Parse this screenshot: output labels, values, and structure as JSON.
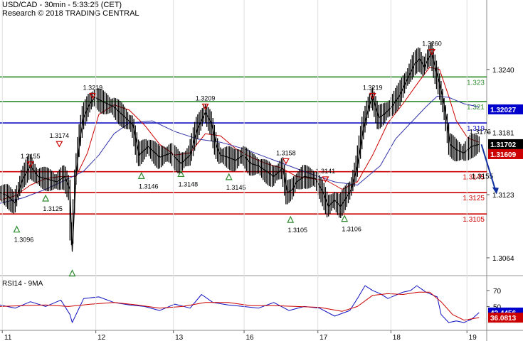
{
  "header": {
    "title": "USD/CAD - 30min - 5:33:25 (CET)",
    "subtitle": "Research © 2018 TRADING CENTRAL"
  },
  "chart_data": [
    {
      "type": "line",
      "panel": "price",
      "y_axis": {
        "ticks": [
          1.324,
          1.3181,
          1.3123,
          1.3064
        ],
        "tick_labels": [
          "1.3240",
          "1.3181",
          "1.3123",
          "1.3064"
        ],
        "ylim": [
          1.305,
          1.3285
        ],
        "side": "right"
      },
      "x_axis": {
        "tick_labels": [
          "11",
          "12",
          "13",
          "16",
          "17",
          "18",
          "19"
        ],
        "tick_index": [
          3,
          126,
          228,
          321,
          418,
          514,
          614
        ],
        "xlim": [
          0,
          640
        ]
      },
      "price_labels": [
        {
          "label": "1.32027",
          "value": 1.32027,
          "color": "#0000cc"
        },
        {
          "label": "1.31702",
          "value": 1.31702,
          "color": "#000000"
        },
        {
          "label": "1.31609",
          "value": 1.31609,
          "color": "#cc0000"
        }
      ],
      "levels": [
        {
          "label": "1.323",
          "value": 1.3233,
          "color": "#2e8b2e"
        },
        {
          "label": "1.321",
          "value": 1.321,
          "color": "#2e8b2e"
        },
        {
          "label": "1.319",
          "value": 1.319,
          "color": "#1010c0"
        },
        {
          "label": "1.3145",
          "value": 1.31445,
          "color": "#cc0000"
        },
        {
          "label": "1.3125",
          "value": 1.3125,
          "color": "#cc0000"
        },
        {
          "label": "1.3105",
          "value": 1.3105,
          "color": "#cc0000"
        }
      ],
      "level_notes": [
        {
          "label": "1.3176",
          "value": 1.3186,
          "index": 617
        },
        {
          "label": "1.3155",
          "value": 1.31445,
          "index": 620
        }
      ],
      "swing_labels": [
        {
          "kind": "high",
          "label": "1.3155",
          "value": 1.3155,
          "index": 40
        },
        {
          "kind": "high",
          "label": "1.3174",
          "value": 1.3174,
          "index": 78
        },
        {
          "kind": "high",
          "label": "1.3219",
          "value": 1.3219,
          "index": 122
        },
        {
          "kind": "high",
          "label": "1.3209",
          "value": 1.3209,
          "index": 270
        },
        {
          "kind": "high",
          "label": "1.3158",
          "value": 1.3158,
          "index": 376
        },
        {
          "kind": "high",
          "label": "1.3141",
          "value": 1.3141,
          "index": 428
        },
        {
          "kind": "high",
          "label": "1.3219",
          "value": 1.3219,
          "index": 490
        },
        {
          "kind": "high",
          "label": "1.3260",
          "value": 1.326,
          "index": 568
        },
        {
          "kind": "low",
          "label": "1.3096",
          "value": 1.3096,
          "index": 22
        },
        {
          "kind": "low",
          "label": "1.3125",
          "value": 1.3125,
          "index": 60
        },
        {
          "kind": "low",
          "label": "1.3146",
          "value": 1.3146,
          "index": 186
        },
        {
          "kind": "low",
          "label": "1.3148",
          "value": 1.3148,
          "index": 238
        },
        {
          "kind": "low",
          "label": "1.3145",
          "value": 1.3145,
          "index": 301
        },
        {
          "kind": "low",
          "label": "1.3105",
          "value": 1.3105,
          "index": 382
        },
        {
          "kind": "low",
          "label": "1.3106",
          "value": 1.3106,
          "index": 453
        },
        {
          "kind": "low",
          "label": "",
          "value": 1.3055,
          "index": 95
        }
      ],
      "series": [
        {
          "name": "",
          "role": "price",
          "color": "#000000",
          "x": [
            0,
            10,
            20,
            30,
            40,
            50,
            60,
            75,
            85,
            92,
            95,
            100,
            105,
            110,
            118,
            125,
            135,
            150,
            165,
            175,
            183,
            195,
            210,
            225,
            238,
            250,
            260,
            270,
            278,
            285,
            290,
            300,
            310,
            320,
            330,
            340,
            350,
            360,
            372,
            378,
            385,
            390,
            400,
            415,
            425,
            432,
            440,
            448,
            455,
            462,
            470,
            478,
            485,
            490,
            498,
            505,
            515,
            525,
            535,
            545,
            552,
            558,
            563,
            568,
            573,
            577,
            582,
            587,
            592,
            600,
            610,
            620,
            630
          ],
          "y": [
            1.3125,
            1.3122,
            1.3115,
            1.3138,
            1.315,
            1.314,
            1.3138,
            1.3135,
            1.314,
            1.3128,
            1.307,
            1.314,
            1.3175,
            1.3195,
            1.3208,
            1.3214,
            1.321,
            1.3205,
            1.3195,
            1.3188,
            1.316,
            1.3168,
            1.3158,
            1.3162,
            1.3152,
            1.316,
            1.3185,
            1.32,
            1.319,
            1.3168,
            1.316,
            1.3158,
            1.3155,
            1.316,
            1.3152,
            1.315,
            1.3145,
            1.314,
            1.3148,
            1.3125,
            1.3128,
            1.3135,
            1.314,
            1.3138,
            1.3125,
            1.3112,
            1.3118,
            1.3112,
            1.312,
            1.3128,
            1.315,
            1.3185,
            1.3205,
            1.3215,
            1.3195,
            1.3198,
            1.3205,
            1.3215,
            1.323,
            1.3245,
            1.325,
            1.3242,
            1.325,
            1.3255,
            1.324,
            1.323,
            1.3215,
            1.3195,
            1.317,
            1.3165,
            1.3162,
            1.3168,
            1.317
          ]
        },
        {
          "name": "",
          "role": "ma-fast",
          "color": "#cc0000",
          "x": [
            0,
            20,
            40,
            60,
            80,
            100,
            115,
            130,
            150,
            170,
            190,
            210,
            230,
            250,
            270,
            290,
            310,
            330,
            350,
            370,
            390,
            410,
            430,
            450,
            470,
            490,
            510,
            530,
            550,
            565,
            578,
            590,
            600,
            615,
            630
          ],
          "y": [
            1.3118,
            1.3122,
            1.3132,
            1.3138,
            1.314,
            1.314,
            1.3162,
            1.3198,
            1.3207,
            1.3202,
            1.3188,
            1.317,
            1.316,
            1.3162,
            1.318,
            1.3178,
            1.3166,
            1.3158,
            1.3152,
            1.3148,
            1.314,
            1.3138,
            1.3136,
            1.3128,
            1.3135,
            1.316,
            1.319,
            1.3208,
            1.3228,
            1.3242,
            1.324,
            1.3215,
            1.3192,
            1.3176,
            1.3172
          ]
        },
        {
          "name": "",
          "role": "ma-slow",
          "color": "#3333aa",
          "x": [
            0,
            30,
            60,
            90,
            110,
            130,
            150,
            170,
            200,
            230,
            260,
            290,
            320,
            350,
            380,
            410,
            440,
            470,
            500,
            520,
            540,
            560,
            575,
            590,
            610,
            630
          ],
          "y": [
            1.3115,
            1.312,
            1.3128,
            1.3138,
            1.3145,
            1.316,
            1.318,
            1.319,
            1.3192,
            1.3182,
            1.3175,
            1.3172,
            1.3166,
            1.3158,
            1.315,
            1.3142,
            1.3135,
            1.3132,
            1.315,
            1.3175,
            1.319,
            1.3205,
            1.3215,
            1.3214,
            1.3208,
            1.3205
          ]
        }
      ],
      "projection": {
        "from": [
          633,
          1.317
        ],
        "to": [
          652,
          1.3126
        ]
      }
    },
    {
      "type": "line",
      "panel": "rsi",
      "title": "RSI14 - 9MA",
      "y_axis": {
        "ticks": [
          70,
          50
        ],
        "tick_labels": [
          "70",
          "50"
        ],
        "ylim": [
          22,
          85
        ],
        "side": "right"
      },
      "value_labels": [
        {
          "label": "42.4456",
          "value": 42.4456,
          "color": "#0000cc"
        },
        {
          "label": "36.0813",
          "value": 36.0813,
          "color": "#cc0000"
        }
      ],
      "series": [
        {
          "name": "",
          "role": "rsi",
          "color": "#1010c0",
          "x": [
            0,
            20,
            40,
            60,
            80,
            92,
            95,
            110,
            130,
            150,
            170,
            190,
            210,
            230,
            250,
            265,
            280,
            300,
            320,
            340,
            360,
            380,
            400,
            420,
            440,
            460,
            470,
            480,
            490,
            500,
            510,
            520,
            530,
            540,
            548,
            560,
            575,
            580,
            590,
            600,
            610,
            620,
            630
          ],
          "y": [
            52,
            48,
            56,
            50,
            58,
            40,
            30,
            60,
            62,
            55,
            52,
            50,
            45,
            53,
            48,
            65,
            55,
            52,
            50,
            48,
            55,
            45,
            50,
            48,
            38,
            45,
            60,
            76,
            70,
            66,
            60,
            64,
            68,
            70,
            76,
            68,
            62,
            40,
            30,
            32,
            30,
            34,
            42.4456
          ]
        },
        {
          "name": "",
          "role": "rsi-ma",
          "color": "#cc0000",
          "x": [
            0,
            30,
            60,
            90,
            120,
            150,
            180,
            210,
            240,
            270,
            300,
            330,
            360,
            390,
            420,
            450,
            470,
            490,
            510,
            530,
            550,
            565,
            580,
            595,
            610,
            630
          ],
          "y": [
            50,
            51,
            52,
            50,
            53,
            55,
            52,
            48,
            50,
            55,
            55,
            51,
            51,
            50,
            49,
            44,
            50,
            64,
            66,
            65,
            68,
            68,
            56,
            40,
            33,
            36.0813
          ]
        }
      ]
    }
  ]
}
